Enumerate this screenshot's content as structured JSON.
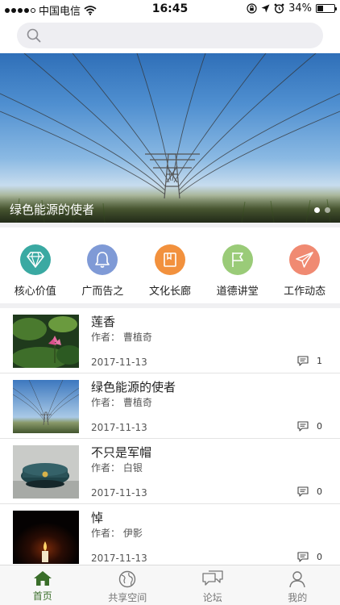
{
  "status_bar": {
    "carrier": "中国电信",
    "time": "16:45",
    "battery": "34%",
    "battery_level": 0.34
  },
  "search": {
    "placeholder": ""
  },
  "banner": {
    "caption": "绿色能源的使者",
    "page_count": 2,
    "active_page": 1
  },
  "categories": [
    {
      "label": "核心价值",
      "icon": "diamond-icon",
      "color": "#3aa9a2"
    },
    {
      "label": "广而告之",
      "icon": "bell-icon",
      "color": "#7f9ad6"
    },
    {
      "label": "文化长廊",
      "icon": "book-icon",
      "color": "#f2913d"
    },
    {
      "label": "道德讲堂",
      "icon": "flag-icon",
      "color": "#9acb78"
    },
    {
      "label": "工作动态",
      "icon": "paper-plane-icon",
      "color": "#f08a72"
    }
  ],
  "articles": [
    {
      "title": "莲香",
      "author": "作者： 曹植奇",
      "date": "2017-11-13",
      "comments": "1",
      "thumb": "lotus"
    },
    {
      "title": "绿色能源的使者",
      "author": "作者： 曹植奇",
      "date": "2017-11-13",
      "comments": "0",
      "thumb": "power-tower"
    },
    {
      "title": "不只是军帽",
      "author": "作者： 白银",
      "date": "2017-11-13",
      "comments": "0",
      "thumb": "military-cap"
    },
    {
      "title": "悼",
      "author": "作者： 伊影",
      "date": "2017-11-13",
      "comments": "0",
      "thumb": "candle"
    }
  ],
  "tabbar": {
    "active_color": "#3a6e2a",
    "tabs": [
      {
        "label": "首页",
        "icon": "home-icon",
        "active": true
      },
      {
        "label": "共享空间",
        "icon": "globe-icon",
        "active": false
      },
      {
        "label": "论坛",
        "icon": "chat-bubbles-icon",
        "active": false
      },
      {
        "label": "我的",
        "icon": "person-icon",
        "active": false
      }
    ]
  }
}
